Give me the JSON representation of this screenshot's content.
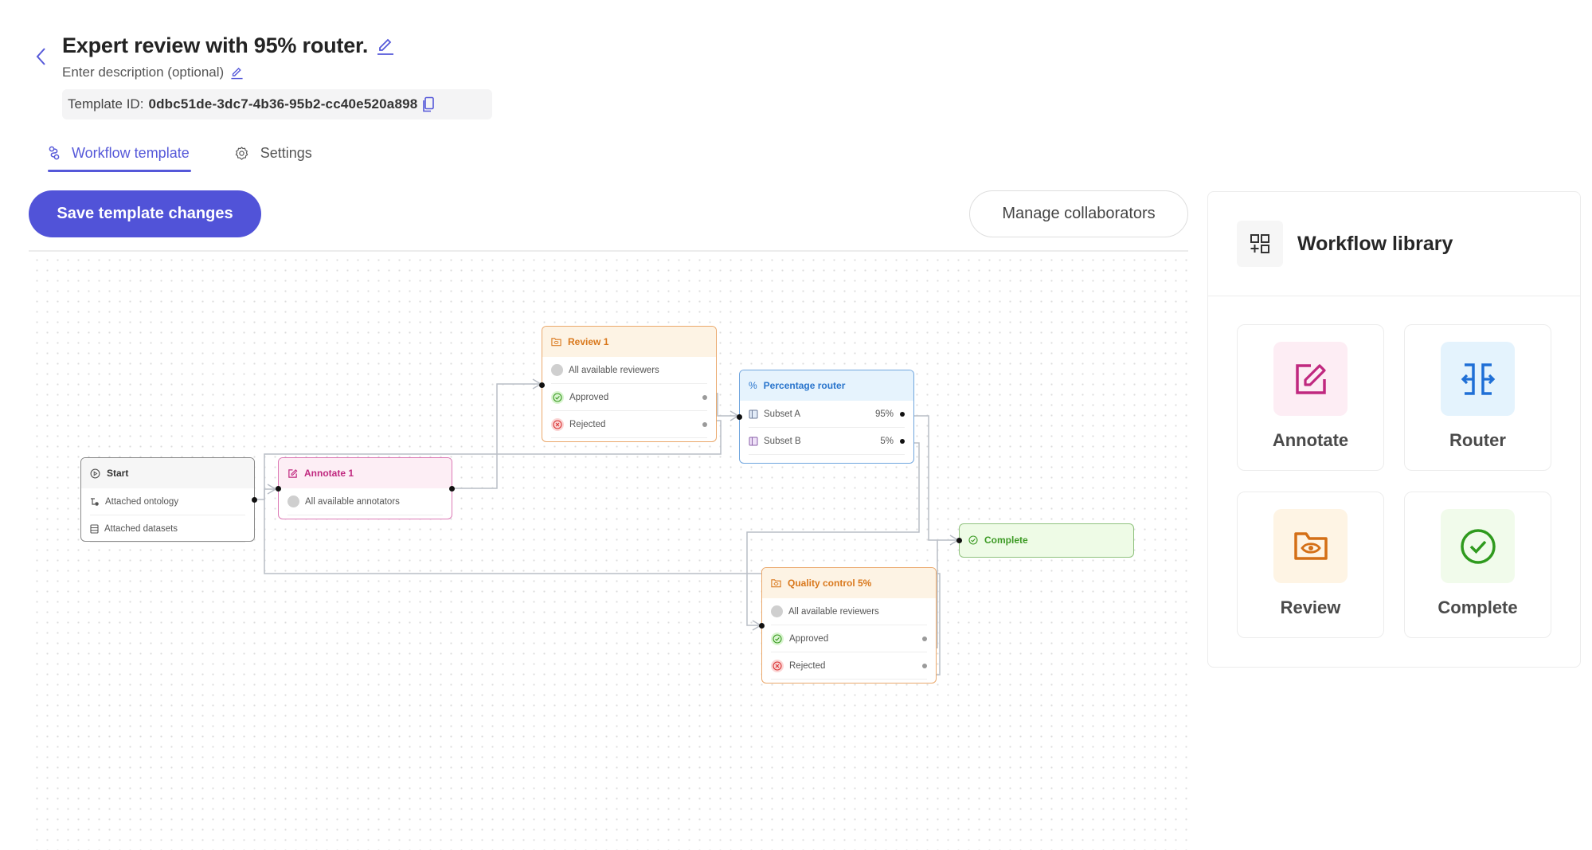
{
  "header": {
    "title": "Expert review with 95% router.",
    "description_placeholder": "Enter description (optional)",
    "template_id_label": "Template ID:",
    "template_id_value": "0dbc51de-3dc7-4b36-95b2-cc40e520a898"
  },
  "tabs": [
    {
      "label": "Workflow template",
      "icon": "workflow-icon",
      "active": true
    },
    {
      "label": "Settings",
      "icon": "gear-icon",
      "active": false
    }
  ],
  "toolbar": {
    "save_label": "Save template changes",
    "collaborators_label": "Manage collaborators"
  },
  "colors": {
    "accent": "#5153d8",
    "annotate": "#c0287f",
    "review": "#d9781c",
    "router": "#2874cc",
    "complete": "#3c9a24"
  },
  "nodes": {
    "start": {
      "title": "Start",
      "rows": [
        "Attached ontology",
        "Attached datasets"
      ]
    },
    "annotate": {
      "title": "Annotate 1",
      "rows": [
        "All available annotators"
      ]
    },
    "review": {
      "title": "Review 1",
      "assignees": "All available reviewers",
      "approved": "Approved",
      "rejected": "Rejected"
    },
    "router": {
      "title": "Percentage router",
      "subsets": [
        {
          "label": "Subset A",
          "percent": "95%"
        },
        {
          "label": "Subset B",
          "percent": "5%"
        }
      ]
    },
    "complete": {
      "title": "Complete"
    },
    "qc": {
      "title": "Quality control 5%",
      "assignees": "All available reviewers",
      "approved": "Approved",
      "rejected": "Rejected"
    }
  },
  "library": {
    "title": "Workflow library",
    "items": [
      {
        "label": "Annotate",
        "icon": "annotate-icon",
        "color": "#c0287f",
        "bg": "#fdedf4"
      },
      {
        "label": "Router",
        "icon": "router-icon",
        "color": "#1f6fd6",
        "bg": "#e4f3fd"
      },
      {
        "label": "Review",
        "icon": "review-folder-eye-icon",
        "color": "#d46f16",
        "bg": "#fef4e4"
      },
      {
        "label": "Complete",
        "icon": "check-circle-icon",
        "color": "#2f9a1e",
        "bg": "#f1fbeb"
      }
    ]
  }
}
